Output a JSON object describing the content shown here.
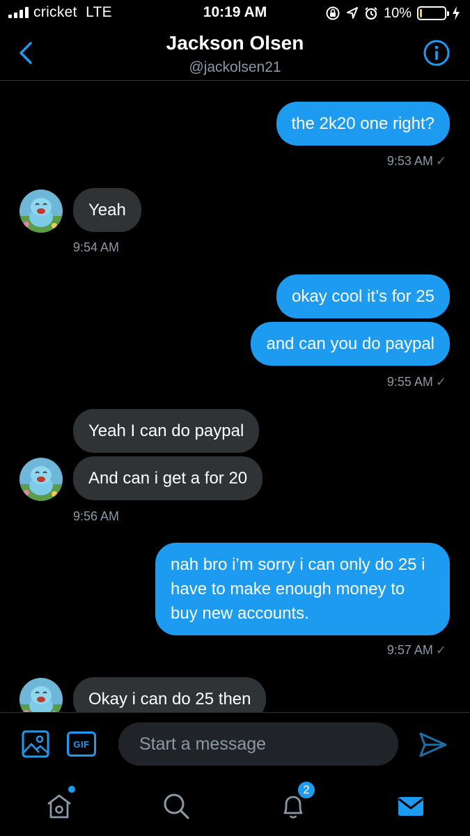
{
  "status_bar": {
    "carrier": "cricket",
    "network": "LTE",
    "time": "10:19 AM",
    "battery_percent": "10%",
    "battery_level": 0.1,
    "icons": [
      "signal-bars-icon",
      "orientation-lock-icon",
      "location-arrow-icon",
      "alarm-icon",
      "battery-icon",
      "charging-bolt-icon"
    ]
  },
  "header": {
    "name": "Jackson Olsen",
    "handle": "@jackolsen21",
    "back_icon": "chevron-left-icon",
    "info_icon": "info-icon"
  },
  "messages": [
    {
      "side": "out",
      "text": "the 2k20 one right?"
    },
    {
      "side": "timestamp-out",
      "text": "9:53 AM",
      "check": "✓"
    },
    {
      "side": "in",
      "text": "Yeah"
    },
    {
      "side": "timestamp-in",
      "text": "9:54 AM"
    },
    {
      "side": "out",
      "text": "okay cool it’s for 25"
    },
    {
      "side": "out",
      "text": "and can you do paypal"
    },
    {
      "side": "timestamp-out",
      "text": "9:55 AM",
      "check": "✓"
    },
    {
      "side": "in",
      "text": "Yeah I can do paypal"
    },
    {
      "side": "in",
      "text": "And can i get a for 20"
    },
    {
      "side": "timestamp-in",
      "text": "9:56 AM"
    },
    {
      "side": "out",
      "text": "nah bro i’m sorry i can only do 25 i have to make enough money to buy new accounts."
    },
    {
      "side": "timestamp-out",
      "text": "9:57 AM",
      "check": "✓"
    },
    {
      "side": "in",
      "text": "Okay i can do 25 then"
    }
  ],
  "composer": {
    "placeholder": "Start a message",
    "gif_label": "GIF",
    "media_icon": "image-icon",
    "send_icon": "send-icon"
  },
  "tabbar": {
    "tabs": [
      "home-icon",
      "search-icon",
      "notifications-icon",
      "messages-icon"
    ],
    "notifications_badge": "2",
    "active_tab": "messages-icon"
  },
  "colors": {
    "accent": "#1d9bf0",
    "incoming_bubble": "#2f3336",
    "background": "#000000",
    "battery_fill": "#ffd60a"
  }
}
